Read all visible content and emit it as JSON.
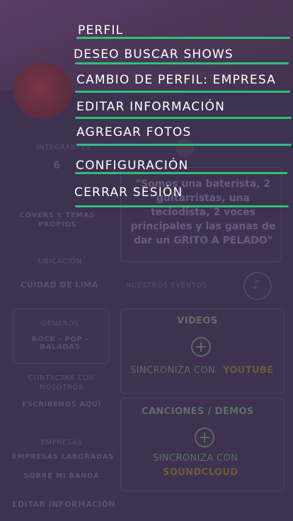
{
  "menu": {
    "items": [
      {
        "label": "PERFIL"
      },
      {
        "label": "DESEO BUSCAR SHOWS"
      },
      {
        "label": "CAMBIO DE PERFIL: EMPRESA"
      },
      {
        "label": "EDITAR INFORMACIÓN"
      },
      {
        "label": "AGREGAR FOTOS"
      },
      {
        "label": "CONFIGURACIÓN"
      },
      {
        "label": "CERRAR SESIÓN"
      }
    ],
    "accent_color": "#2ec07a"
  },
  "profile": {
    "integrantes_label": "INTEGRANTES",
    "integrantes_value": "6",
    "genre_label": "COVERS Y TEMAS PROPIOS",
    "ubicacion_label": "UBICACIÓN",
    "ubicacion_value": "CUIDAD DE LIMA",
    "generos_label": "GÉNEROS",
    "generos_value": "ROCK - POP - BALADAS",
    "quote": "\"Somos una baterista, 2 guitarristas, una teclodista, 2 voces principales y las ganas de dar un GRITO A PELADO\"",
    "nuestros_eventos": "NUESTROS EVENTOS",
    "videos_title": "VIDEOS",
    "sync_youtube_prefix": "SINCRONIZA CON",
    "sync_youtube_brand": "YOUTUBE",
    "canciones_title": "CANCIONES / DEMOS",
    "sync_sound_prefix": "SINCRONIZA CON",
    "sync_sound_brand": "SOUNDCLOUD",
    "contacto_1": "CONTACTAR CON NOSOTROS",
    "contacto_2": "ESCRÍBENOS AQUÍ",
    "empresas_label": "EMPRESAS",
    "empresas_value": "EMPRESAS LABORADAS",
    "sobre_label": "SOBRE MI BANDA",
    "editar_info": "EDITAR INFORMACIÓN"
  }
}
